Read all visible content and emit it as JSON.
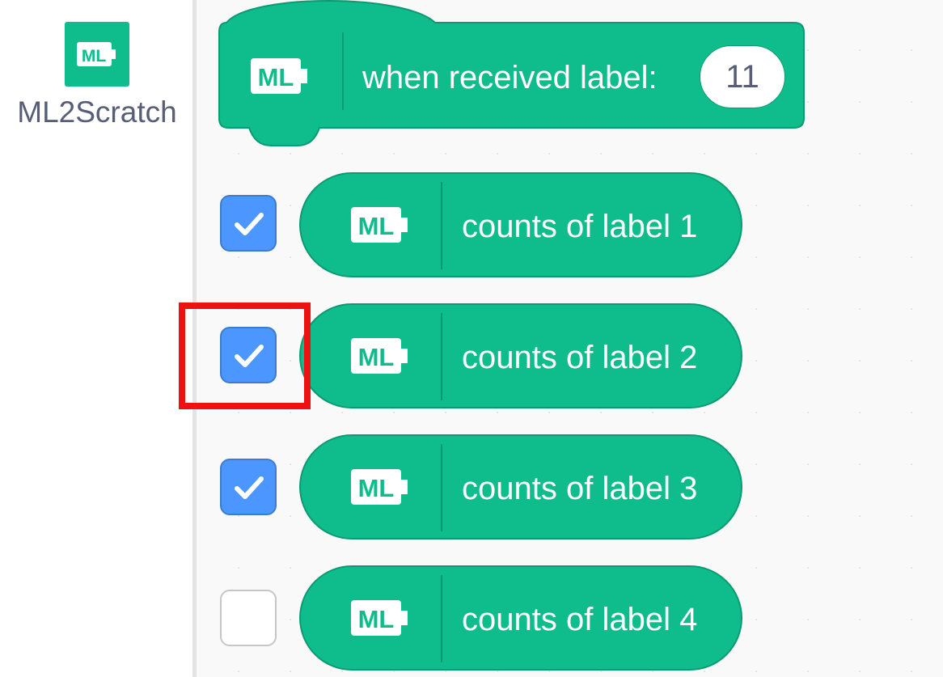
{
  "category": {
    "label": "ML2Scratch",
    "icon": "ml-extension-icon",
    "color": "#0fbd8c"
  },
  "blocks": {
    "hat": {
      "icon": "ml-extension-icon",
      "text": "when received label:",
      "input_value": "11"
    },
    "reporters": [
      {
        "icon": "ml-extension-icon",
        "text": "counts of label 1",
        "checked": true
      },
      {
        "icon": "ml-extension-icon",
        "text": "counts of label 2",
        "checked": true
      },
      {
        "icon": "ml-extension-icon",
        "text": "counts of label 3",
        "checked": true
      },
      {
        "icon": "ml-extension-icon",
        "text": "counts of label 4",
        "checked": false
      }
    ]
  },
  "colors": {
    "block_fill": "#0fbd8c",
    "block_border": "#0b9a72",
    "checkbox_checked": "#4c97ff",
    "highlight": "#ee1111"
  }
}
